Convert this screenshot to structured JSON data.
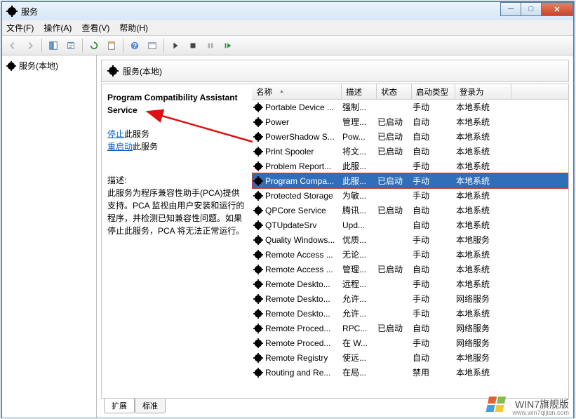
{
  "title": "服务",
  "menus": [
    "文件(F)",
    "操作(A)",
    "查看(V)",
    "帮助(H)"
  ],
  "left_node": "服务(本地)",
  "pane_header": "服务(本地)",
  "service_title": "Program Compatibility Assistant Service",
  "links": {
    "stop": "停止",
    "stop_suffix": "此服务",
    "restart": "重启动",
    "restart_suffix": "此服务"
  },
  "desc_label": "描述:",
  "desc_text": "此服务为程序兼容性助手(PCA)提供支持。PCA 监视由用户安装和运行的程序，并检测已知兼容性问题。如果停止此服务，PCA 将无法正常运行。",
  "columns": [
    "名称",
    "描述",
    "状态",
    "启动类型",
    "登录为"
  ],
  "rows": [
    {
      "n": "Portable Device ...",
      "d": "强制...",
      "s": "",
      "t": "手动",
      "l": "本地系统"
    },
    {
      "n": "Power",
      "d": "管理...",
      "s": "已启动",
      "t": "自动",
      "l": "本地系统"
    },
    {
      "n": "PowerShadow S...",
      "d": "Pow...",
      "s": "已启动",
      "t": "自动",
      "l": "本地系统"
    },
    {
      "n": "Print Spooler",
      "d": "将文...",
      "s": "已启动",
      "t": "自动",
      "l": "本地系统"
    },
    {
      "n": "Problem Report...",
      "d": "此服...",
      "s": "",
      "t": "手动",
      "l": "本地系统"
    },
    {
      "n": "Program Compa...",
      "d": "此服...",
      "s": "已启动",
      "t": "手动",
      "l": "本地系统",
      "sel": true
    },
    {
      "n": "Protected Storage",
      "d": "为敏...",
      "s": "",
      "t": "手动",
      "l": "本地系统"
    },
    {
      "n": "QPCore Service",
      "d": "腾讯...",
      "s": "已启动",
      "t": "自动",
      "l": "本地系统"
    },
    {
      "n": "QTUpdateSrv",
      "d": "Upd...",
      "s": "",
      "t": "自动",
      "l": "本地系统"
    },
    {
      "n": "Quality Windows...",
      "d": "优质...",
      "s": "",
      "t": "手动",
      "l": "本地服务"
    },
    {
      "n": "Remote Access ...",
      "d": "无论...",
      "s": "",
      "t": "手动",
      "l": "本地系统"
    },
    {
      "n": "Remote Access ...",
      "d": "管理...",
      "s": "已启动",
      "t": "自动",
      "l": "本地系统"
    },
    {
      "n": "Remote Deskto...",
      "d": "远程...",
      "s": "",
      "t": "手动",
      "l": "本地系统"
    },
    {
      "n": "Remote Deskto...",
      "d": "允许...",
      "s": "",
      "t": "手动",
      "l": "网络服务"
    },
    {
      "n": "Remote Deskto...",
      "d": "允许...",
      "s": "",
      "t": "手动",
      "l": "本地系统"
    },
    {
      "n": "Remote Proced...",
      "d": "RPC...",
      "s": "已启动",
      "t": "自动",
      "l": "网络服务"
    },
    {
      "n": "Remote Proced...",
      "d": "在 W...",
      "s": "",
      "t": "手动",
      "l": "网络服务"
    },
    {
      "n": "Remote Registry",
      "d": "使远...",
      "s": "",
      "t": "自动",
      "l": "本地服务"
    },
    {
      "n": "Routing and Re...",
      "d": "在局...",
      "s": "",
      "t": "禁用",
      "l": "本地系统"
    }
  ],
  "tabs": [
    "扩展",
    "标准"
  ],
  "watermark": {
    "brand": "WIN7旗舰版",
    "url": "www.win7qijian.com"
  }
}
